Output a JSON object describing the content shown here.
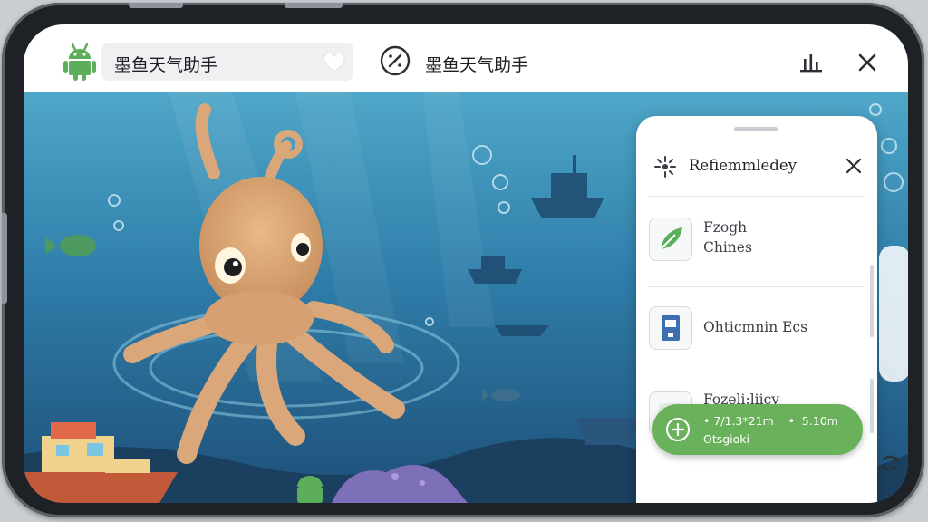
{
  "header": {
    "app_chip_title": "墨鱼天气助手",
    "app_title": "墨鱼天气助手"
  },
  "icons": {
    "android": "android-icon",
    "favorite": "heart-icon",
    "compass": "compass-icon",
    "stats": "bar-chart-icon",
    "close": "close-icon",
    "sparkle": "sparkle-icon",
    "plus": "plus-circle-icon",
    "refresh": "refresh-icon"
  },
  "panel": {
    "title": "Refiemmledey",
    "items": [
      {
        "label_line1": "Fzogh",
        "label_line2": "Chines",
        "icon": "leaf-icon"
      },
      {
        "label_line1": "Ohticmnin Ecs",
        "label_line2": "",
        "icon": "device-icon"
      },
      {
        "label_line1": "Fozeli:liicy",
        "label_line2": "",
        "icon": "image-icon"
      }
    ]
  },
  "fab": {
    "line1": "• 7/1.3*21m    •  5.10m",
    "line2": "Otsgioki"
  },
  "colors": {
    "accent_green": "#69b25b",
    "android_green": "#5dae5a",
    "ocean_blue": "#2a6f9c"
  }
}
